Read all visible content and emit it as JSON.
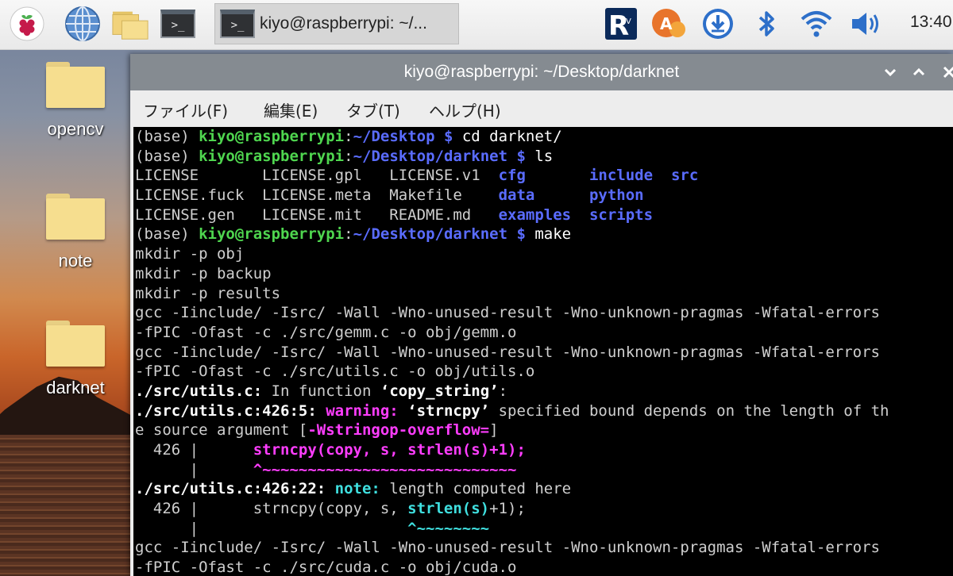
{
  "taskbar": {
    "task_label": "kiyo@raspberrypi: ~/...",
    "clock": "13:40",
    "icons": [
      "raspberry-menu-icon",
      "web-browser-icon",
      "file-manager-icon",
      "terminal-icon",
      "realvnc-icon",
      "input-method-icon",
      "download-icon",
      "bluetooth-icon",
      "wifi-icon",
      "volume-icon"
    ],
    "terminal_glyph": ">_"
  },
  "desktop": {
    "items": [
      {
        "label": "opencv"
      },
      {
        "label": "note"
      },
      {
        "label": "darknet"
      }
    ]
  },
  "window": {
    "title": "kiyo@raspberrypi: ~/Desktop/darknet",
    "buttons": [
      "minimize",
      "maximize",
      "close"
    ],
    "menu": [
      "ファイル(F)",
      "編集(E)",
      "タブ(T)",
      "ヘルプ(H)"
    ]
  },
  "terminal": {
    "colors": {
      "prompt_user": "#4fd64f",
      "path": "#5a6cff",
      "warning": "#ff3dff",
      "note": "#3fdfdf"
    },
    "lines": [
      [
        {
          "t": "(base) ",
          "s": ""
        },
        {
          "t": "kiyo@raspberrypi",
          "s": "g"
        },
        {
          "t": ":",
          "s": ""
        },
        {
          "t": "~/Desktop $",
          "s": "b"
        },
        {
          "t": " cd darknet/",
          "s": "w"
        }
      ],
      [
        {
          "t": "(base) ",
          "s": ""
        },
        {
          "t": "kiyo@raspberrypi",
          "s": "g"
        },
        {
          "t": ":",
          "s": ""
        },
        {
          "t": "~/Desktop/darknet $",
          "s": "b"
        },
        {
          "t": " ls",
          "s": "w"
        }
      ],
      [
        {
          "t": "LICENSE       LICENSE.gpl   LICENSE.v1  ",
          "s": ""
        },
        {
          "t": "cfg",
          "s": "dirb"
        },
        {
          "t": "       ",
          "s": ""
        },
        {
          "t": "include",
          "s": "dirb"
        },
        {
          "t": "  ",
          "s": ""
        },
        {
          "t": "src",
          "s": "dirb"
        }
      ],
      [
        {
          "t": "LICENSE.fuck  LICENSE.meta  Makefile    ",
          "s": ""
        },
        {
          "t": "data",
          "s": "dirb"
        },
        {
          "t": "      ",
          "s": ""
        },
        {
          "t": "python",
          "s": "dirb"
        }
      ],
      [
        {
          "t": "LICENSE.gen   LICENSE.mit   README.md   ",
          "s": ""
        },
        {
          "t": "examples",
          "s": "dirb"
        },
        {
          "t": "  ",
          "s": ""
        },
        {
          "t": "scripts",
          "s": "dirb"
        }
      ],
      [
        {
          "t": "(base) ",
          "s": ""
        },
        {
          "t": "kiyo@raspberrypi",
          "s": "g"
        },
        {
          "t": ":",
          "s": ""
        },
        {
          "t": "~/Desktop/darknet $",
          "s": "b"
        },
        {
          "t": " make",
          "s": "w"
        }
      ],
      [
        {
          "t": "mkdir -p obj",
          "s": ""
        }
      ],
      [
        {
          "t": "mkdir -p backup",
          "s": ""
        }
      ],
      [
        {
          "t": "mkdir -p results",
          "s": ""
        }
      ],
      [
        {
          "t": "gcc -Iinclude/ -Isrc/ -Wall -Wno-unused-result -Wno-unknown-pragmas -Wfatal-errors",
          "s": ""
        }
      ],
      [
        {
          "t": "-fPIC -Ofast -c ./src/gemm.c -o obj/gemm.o",
          "s": ""
        }
      ],
      [
        {
          "t": "gcc -Iinclude/ -Isrc/ -Wall -Wno-unused-result -Wno-unknown-pragmas -Wfatal-errors",
          "s": ""
        }
      ],
      [
        {
          "t": "-fPIC -Ofast -c ./src/utils.c -o obj/utils.o",
          "s": ""
        }
      ],
      [
        {
          "t": "./src/utils.c:",
          "s": "bw"
        },
        {
          "t": " In function ",
          "s": ""
        },
        {
          "t": "‘copy_string’",
          "s": "bw"
        },
        {
          "t": ":",
          "s": ""
        }
      ],
      [
        {
          "t": "./src/utils.c:426:5:",
          "s": "bw"
        },
        {
          "t": " ",
          "s": ""
        },
        {
          "t": "warning:",
          "s": "m"
        },
        {
          "t": " ",
          "s": ""
        },
        {
          "t": "‘strncpy’",
          "s": "bw"
        },
        {
          "t": " specified bound depends on the length of th",
          "s": ""
        }
      ],
      [
        {
          "t": "e source argument [",
          "s": ""
        },
        {
          "t": "-Wstringop-overflow=",
          "s": "m"
        },
        {
          "t": "]",
          "s": ""
        }
      ],
      [
        {
          "t": "  426 |      ",
          "s": ""
        },
        {
          "t": "strncpy(copy, s, strlen(s)+1);",
          "s": "m"
        }
      ],
      [
        {
          "t": "      |      ",
          "s": ""
        },
        {
          "t": "^~~~~~~~~~~~~~~~~~~~~~~~~~~~~",
          "s": "m"
        }
      ],
      [
        {
          "t": "./src/utils.c:426:22:",
          "s": "bw"
        },
        {
          "t": " ",
          "s": ""
        },
        {
          "t": "note:",
          "s": "c"
        },
        {
          "t": " length computed here",
          "s": ""
        }
      ],
      [
        {
          "t": "  426 |      strncpy(copy, s, ",
          "s": ""
        },
        {
          "t": "strlen(s)",
          "s": "c"
        },
        {
          "t": "+1);",
          "s": ""
        }
      ],
      [
        {
          "t": "      |                       ",
          "s": ""
        },
        {
          "t": "^~~~~~~~~",
          "s": "c"
        }
      ],
      [
        {
          "t": "gcc -Iinclude/ -Isrc/ -Wall -Wno-unused-result -Wno-unknown-pragmas -Wfatal-errors",
          "s": ""
        }
      ],
      [
        {
          "t": "-fPIC -Ofast -c ./src/cuda.c -o obj/cuda.o",
          "s": ""
        }
      ]
    ]
  }
}
